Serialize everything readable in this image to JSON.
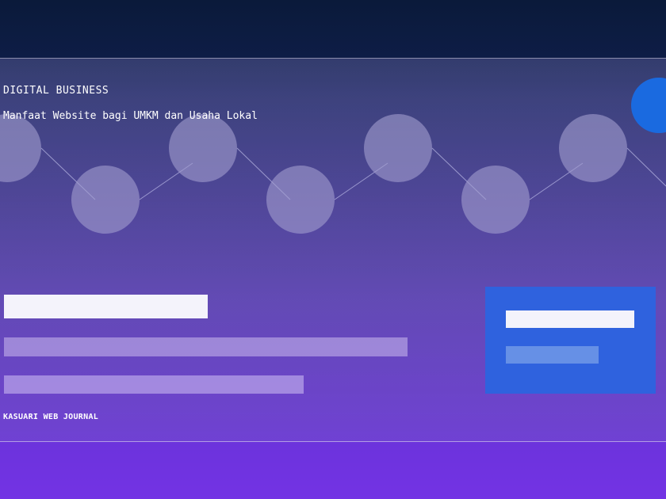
{
  "header": {
    "kicker": "DIGITAL BUSINESS",
    "headline": "Manfaat Website bagi UMKM dan Usaha Lokal"
  },
  "footer": {
    "label": "KASUARI WEB JOURNAL"
  },
  "colors": {
    "accent_circle": "#1a6ae0",
    "card": "#2f62de",
    "node": "#9a94c8"
  },
  "decoration": {
    "network_nodes": 8
  }
}
